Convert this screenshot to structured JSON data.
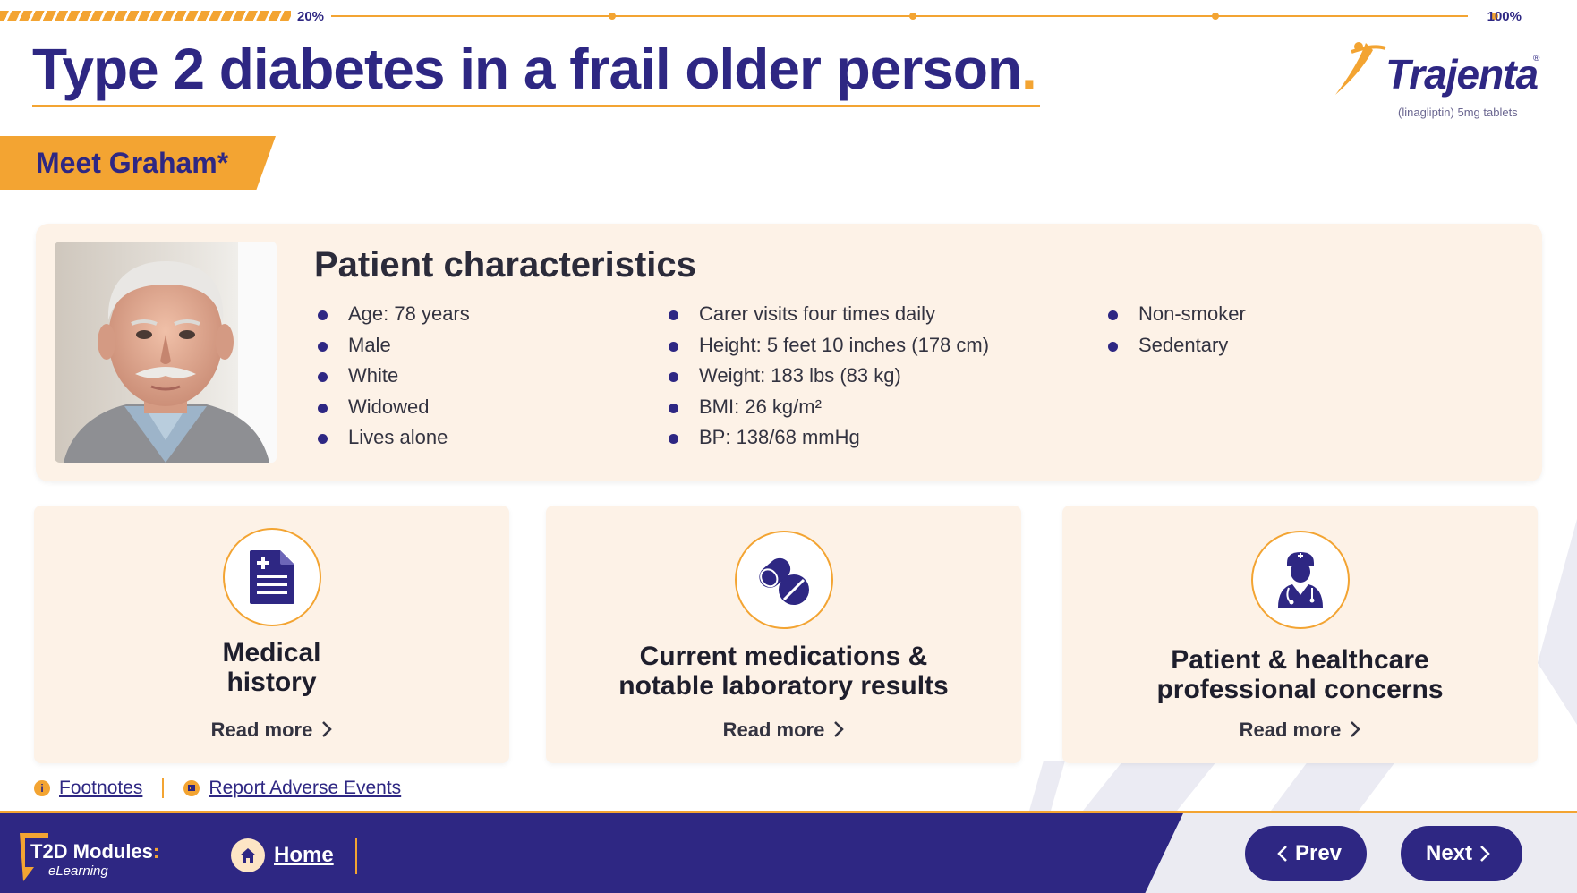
{
  "progress": {
    "percent": 20,
    "start_label": "20%",
    "end_label": "100%"
  },
  "header": {
    "title": "Type 2 diabetes in a frail older person",
    "title_dot": "."
  },
  "logo": {
    "name": "Trajenta",
    "registered": "®",
    "subtitle": "(linagliptin) 5mg tablets"
  },
  "meet_tag": "Meet Graham*",
  "patient": {
    "section_title": "Patient characteristics",
    "columns": [
      [
        "Age: 78 years",
        "Male",
        "White",
        "Widowed",
        "Lives alone"
      ],
      [
        "Carer visits four times daily",
        "Height: 5 feet 10 inches (178 cm)",
        "Weight: 183 lbs (83 kg)",
        "BMI: 26 kg/m²",
        "BP: 138/68 mmHg"
      ],
      [
        "Non-smoker",
        "Sedentary"
      ]
    ]
  },
  "cards": [
    {
      "title_line1": "Medical",
      "title_line2": "history",
      "read_more": "Read more",
      "icon": "medical-record-icon"
    },
    {
      "title_line1": "Current medications &",
      "title_line2": "notable laboratory results",
      "read_more": "Read more",
      "icon": "pills-icon"
    },
    {
      "title_line1": "Patient & healthcare",
      "title_line2": "professional concerns",
      "read_more": "Read more",
      "icon": "doctor-icon"
    }
  ],
  "links": {
    "footnotes": "Footnotes",
    "footnotes_icon": "i",
    "adverse": "Report Adverse Events"
  },
  "footer": {
    "brand_title": "T2D Modules",
    "brand_colon": ":",
    "brand_sub": "eLearning",
    "home": "Home",
    "prev": "Prev",
    "next": "Next"
  },
  "colors": {
    "navy": "#2e2783",
    "orange": "#f3a432",
    "card_bg": "#fdf2e7"
  }
}
